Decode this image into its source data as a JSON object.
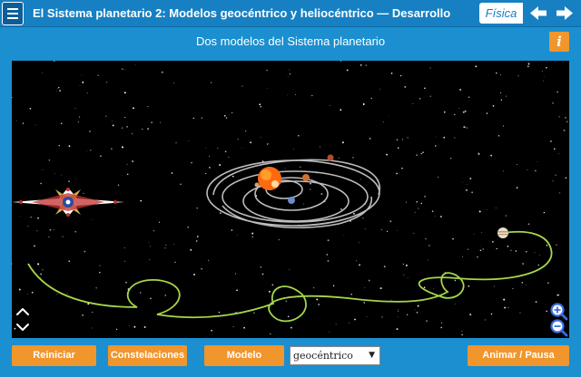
{
  "header": {
    "title": "El Sistema planetario 2: Modelos geocéntrico y heliocéntrico  —  Desarrollo",
    "subject": "Física"
  },
  "subtitle": "Dos modelos del Sistema planetario",
  "info_label": "i",
  "controls": {
    "reset_label": "Reiniciar",
    "constellations_label": "Constelaciones",
    "model_label": "Modelo",
    "model_select_value": "geocéntrico",
    "animate_label": "Animar / Pausa"
  },
  "icons": [
    "menu-icon",
    "back-arrow-icon",
    "forward-arrow-icon",
    "info-icon",
    "compass-rose-icon",
    "scroll-up-icon",
    "scroll-down-icon",
    "zoom-in-icon",
    "zoom-out-icon",
    "chevron-down-icon"
  ],
  "colors": {
    "background": "#1b8fcf",
    "topbar": "#1680c3",
    "accent": "#f0962c",
    "sun": "#ff6a10",
    "orbit_lines": "#bdbdbd",
    "trail": "#a6d64a"
  }
}
